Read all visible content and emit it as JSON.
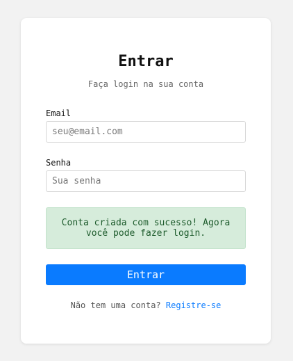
{
  "form": {
    "title": "Entrar",
    "subtitle": "Faça login na sua conta",
    "email": {
      "label": "Email",
      "placeholder": "seu@email.com",
      "value": ""
    },
    "password": {
      "label": "Senha",
      "placeholder": "Sua senha",
      "value": ""
    },
    "alert": {
      "text": "Conta criada com sucesso! Agora você pode fazer login.",
      "type": "success"
    },
    "submit_label": "Entrar",
    "footer": {
      "prompt": "Não tem uma conta?",
      "link_label": "Registre-se"
    }
  },
  "colors": {
    "background": "#f2f2f2",
    "card": "#ffffff",
    "accent": "#0a7bff",
    "success_bg": "#d6ecdb",
    "success_text": "#1d5b2c"
  }
}
